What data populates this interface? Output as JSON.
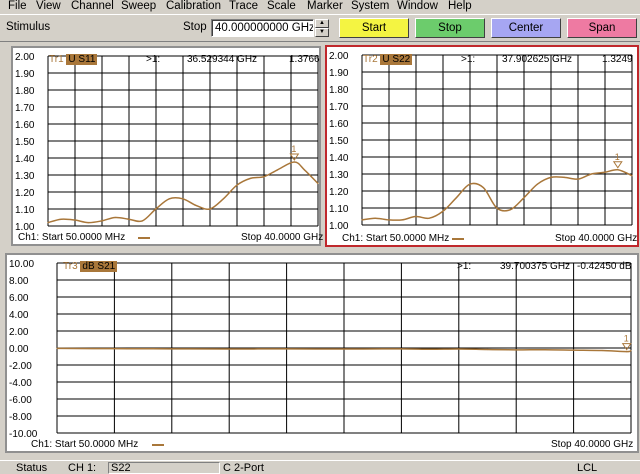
{
  "menu": [
    "File",
    "View",
    "Channel",
    "Sweep",
    "Calibration",
    "Trace",
    "Scale",
    "Marker",
    "System",
    "Window",
    "Help"
  ],
  "stimulus": {
    "label": "Stimulus",
    "stop_label": "Stop",
    "stop_value": "40.000000000 GHz",
    "buttons": [
      {
        "label": "Start",
        "color": "#f4f442"
      },
      {
        "label": "Stop",
        "color": "#6ccc6c"
      },
      {
        "label": "Center",
        "color": "#a6a6f2"
      },
      {
        "label": "Span",
        "color": "#ee7aa2"
      }
    ]
  },
  "trace_color": "#a9773a",
  "traces": [
    {
      "id": "Tr1",
      "param": "U S11",
      "marker_id": ">1:",
      "marker_freq": "36.529344 GHz",
      "marker_value": "1.3766",
      "marker_num": "1",
      "yticks": [
        "2.00",
        "1.90",
        "1.80",
        "1.70",
        "1.60",
        "1.50",
        "1.40",
        "1.30",
        "1.20",
        "1.10",
        "1.00"
      ],
      "footer_start": "Ch1: Start  50.0000 MHz",
      "footer_stop": "Stop  40.0000 GHz",
      "active": false,
      "chart_data": {
        "type": "line",
        "x_range_ghz": [
          0.05,
          40.0
        ],
        "ylim": [
          1.0,
          2.0
        ],
        "x": [
          0.05,
          2,
          4,
          6,
          8,
          10,
          12,
          14,
          16,
          18,
          20,
          22,
          24,
          26,
          28,
          30,
          32,
          34,
          36.5,
          38,
          40
        ],
        "y": [
          1.02,
          1.04,
          1.035,
          1.02,
          1.03,
          1.05,
          1.04,
          1.03,
          1.1,
          1.16,
          1.16,
          1.12,
          1.1,
          1.16,
          1.24,
          1.28,
          1.29,
          1.33,
          1.3766,
          1.33,
          1.25
        ]
      }
    },
    {
      "id": "Tr2",
      "param": "U S22",
      "marker_id": ">1:",
      "marker_freq": "37.902625 GHz",
      "marker_value": "1.3249",
      "marker_num": "1",
      "yticks": [
        "2.00",
        "1.90",
        "1.80",
        "1.70",
        "1.60",
        "1.50",
        "1.40",
        "1.30",
        "1.20",
        "1.10",
        "1.00"
      ],
      "footer_start": "Ch1: Start  50.0000 MHz",
      "footer_stop": "Stop  40.0000 GHz",
      "active": true,
      "chart_data": {
        "type": "line",
        "x_range_ghz": [
          0.05,
          40.0
        ],
        "ylim": [
          1.0,
          2.0
        ],
        "x": [
          0.05,
          2,
          4,
          6,
          8,
          10,
          12,
          14,
          16,
          18,
          20,
          22,
          24,
          26,
          28,
          30,
          32,
          34,
          36,
          37.9,
          40
        ],
        "y": [
          1.03,
          1.04,
          1.03,
          1.03,
          1.05,
          1.04,
          1.08,
          1.16,
          1.24,
          1.22,
          1.1,
          1.09,
          1.16,
          1.24,
          1.28,
          1.28,
          1.27,
          1.3,
          1.31,
          1.3249,
          1.29
        ]
      }
    },
    {
      "id": "Tr3",
      "param": "dB S21",
      "marker_id": ">1:",
      "marker_freq": "39.700375 GHz",
      "marker_value": "-0.42450 dB",
      "marker_num": "1",
      "yticks": [
        "10.00",
        "8.00",
        "6.00",
        "4.00",
        "2.00",
        "0.00",
        "-2.00",
        "-4.00",
        "-6.00",
        "-8.00",
        "-10.00"
      ],
      "footer_start": "Ch1: Start  50.0000 MHz",
      "footer_stop": "Stop  40.0000 GHz",
      "active": false,
      "chart_data": {
        "type": "line",
        "x_range_ghz": [
          0.05,
          40.0
        ],
        "ylim": [
          -10.0,
          10.0
        ],
        "x": [
          0.05,
          4,
          8,
          12,
          16,
          20,
          24,
          26,
          28,
          30,
          32,
          34,
          36,
          38,
          39.7,
          40
        ],
        "y": [
          -0.05,
          -0.08,
          -0.1,
          -0.12,
          -0.1,
          -0.12,
          -0.1,
          -0.15,
          -0.12,
          -0.18,
          -0.22,
          -0.2,
          -0.25,
          -0.3,
          -0.4245,
          -0.3
        ]
      }
    }
  ],
  "status": {
    "label": "Status",
    "channel": "CH 1:",
    "param": "S22",
    "calib": "C  2-Port",
    "remote": "LCL"
  }
}
